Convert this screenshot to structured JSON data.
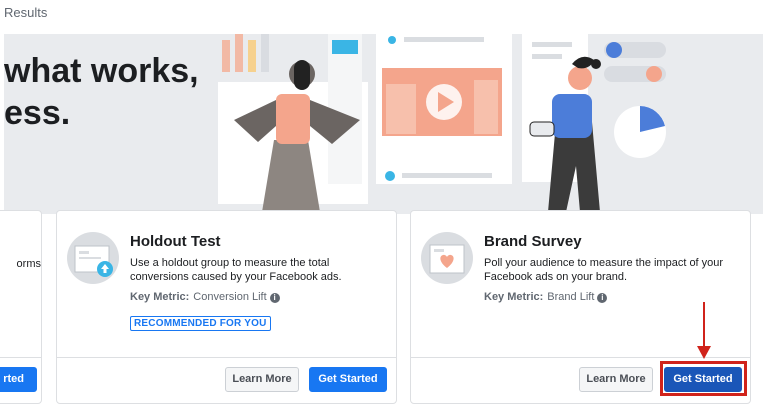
{
  "topbar": {
    "title": "Results"
  },
  "hero": {
    "line1": "what works,",
    "line2": "ess."
  },
  "left_card": {
    "desc_fragment": "orms",
    "button_fragment": "rted"
  },
  "cards": [
    {
      "title": "Holdout Test",
      "description": "Use a holdout group to measure the total conversions caused by your Facebook ads.",
      "metric_label": "Key Metric:",
      "metric_value": "Conversion Lift",
      "badge": "RECOMMENDED FOR YOU",
      "secondary_button": "Learn More",
      "primary_button": "Get Started"
    },
    {
      "title": "Brand Survey",
      "description": "Poll your audience to measure the impact of your Facebook ads on your brand.",
      "metric_label": "Key Metric:",
      "metric_value": "Brand Lift",
      "secondary_button": "Learn More",
      "primary_button": "Get Started"
    }
  ],
  "colors": {
    "accent": "#1877f2",
    "annotation": "#d0231b",
    "hero_bg": "#e9ebee"
  },
  "icons": [
    "info-icon",
    "upload-arrow-icon",
    "heart-icon",
    "play-icon",
    "down-arrow-annotation"
  ]
}
